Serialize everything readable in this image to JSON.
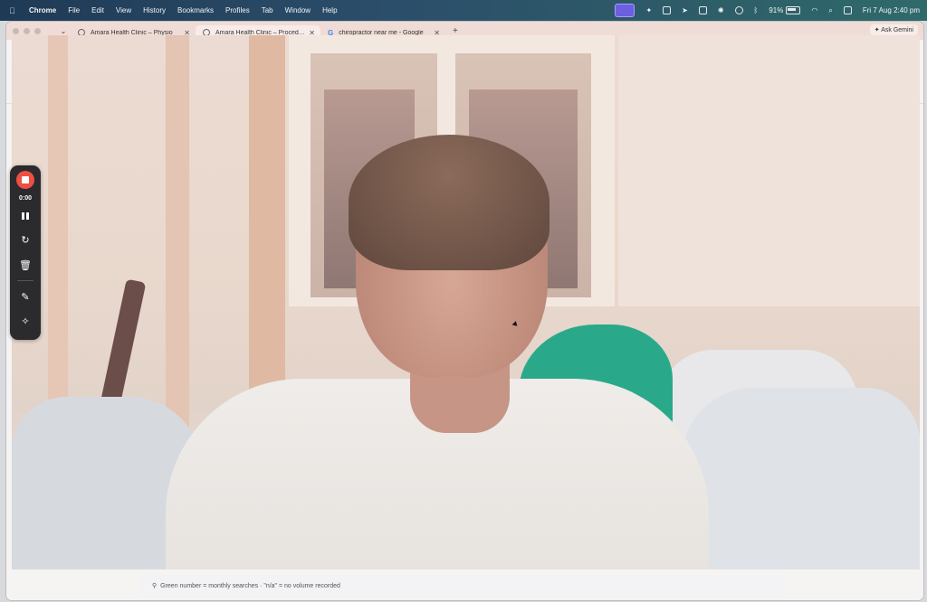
{
  "menubar": {
    "apple": "",
    "items": [
      "Chrome",
      "File",
      "Edit",
      "View",
      "History",
      "Bookmarks",
      "Profiles",
      "Tab",
      "Window",
      "Help"
    ],
    "battery_percent": "91%",
    "datetime": "Fri 7 Aug  2:40 pm",
    "status_icons": [
      "screen-recorder-icon",
      "sparkle-icon",
      "photos-icon",
      "send-icon",
      "box-icon",
      "brightness-icon",
      "vpn-icon",
      "bluetooth-icon",
      "battery-icon",
      "wifi-icon",
      "search-icon",
      "control-center-icon"
    ]
  },
  "browser": {
    "tabs": [
      {
        "title": "Amara Health Clinic – Physio",
        "favicon": "globe-icon"
      },
      {
        "title": "Amara Health Clinic – Procedure",
        "favicon": "globe-icon",
        "active": true
      },
      {
        "title": "chiropractor near me - Google",
        "favicon": "google-icon"
      }
    ],
    "new_tab": "+",
    "ask_gemini": "Ask Gemini",
    "tab_dropdown": "⌄"
  },
  "recorder": {
    "timer": "0:00"
  },
  "footer": {
    "note": "Green number = monthly searches · \"n/a\" = no volume recorded"
  },
  "colors": {
    "record_red": "#ef4f43",
    "toolbar_bg": "#2b2b2e",
    "accent_teal": "#2aa98a"
  }
}
